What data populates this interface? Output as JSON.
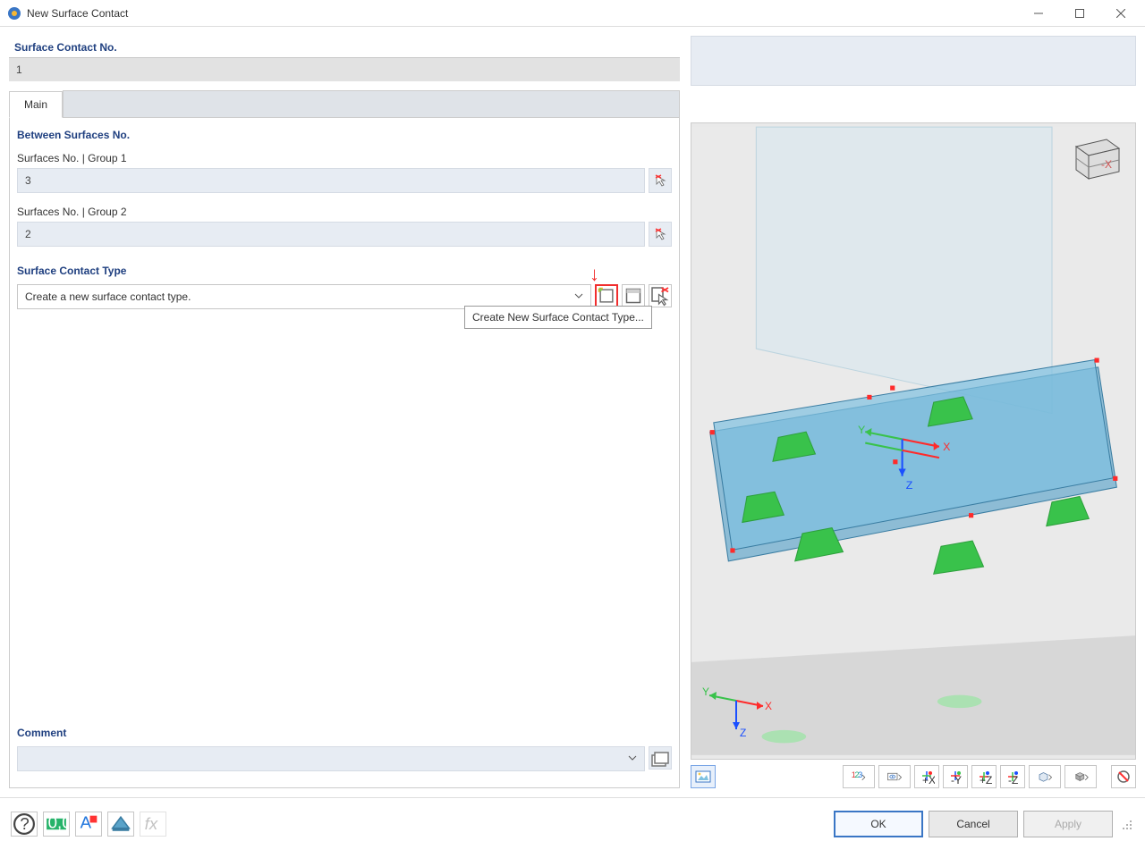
{
  "window": {
    "title": "New Surface Contact"
  },
  "header": {
    "contact_no_label": "Surface Contact No.",
    "contact_no_value": "1"
  },
  "tabs": {
    "main": "Main"
  },
  "between": {
    "section": "Between Surfaces No.",
    "group1_label": "Surfaces No. | Group 1",
    "group1_value": "3",
    "group2_label": "Surfaces No. | Group 2",
    "group2_value": "2"
  },
  "type": {
    "section": "Surface Contact Type",
    "combo_text": "Create a new surface contact type.",
    "tooltip": "Create New Surface Contact Type..."
  },
  "comment": {
    "section": "Comment"
  },
  "buttons": {
    "ok": "OK",
    "cancel": "Cancel",
    "apply": "Apply"
  },
  "axes": {
    "x": "X",
    "y": "Y",
    "z": "Z"
  }
}
